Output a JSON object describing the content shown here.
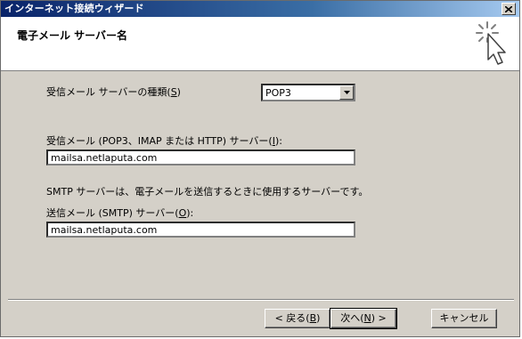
{
  "window": {
    "title": "インターネット接続ウィザード"
  },
  "header": {
    "title": "電子メール サーバー名"
  },
  "form": {
    "incoming_type_label_pre": "受信メール サーバーの種類(",
    "incoming_type_label_key": "S",
    "incoming_type_label_post": ")",
    "incoming_type_value": "POP3",
    "incoming_server_label_pre": "受信メール (POP3、IMAP または HTTP) サーバー(",
    "incoming_server_label_key": "I",
    "incoming_server_label_post": "):",
    "incoming_server_value": "mailsa.netlaputa.com",
    "smtp_note": "SMTP サーバーは、電子メールを送信するときに使用するサーバーです。",
    "outgoing_server_label_pre": "送信メール (SMTP) サーバー(",
    "outgoing_server_label_key": "O",
    "outgoing_server_label_post": "):",
    "outgoing_server_value": "mailsa.netlaputa.com"
  },
  "footer": {
    "back_pre": "< 戻る(",
    "back_key": "B",
    "back_post": ")",
    "next_pre": "次へ(",
    "next_key": "N",
    "next_post": ") >",
    "cancel": "キャンセル"
  },
  "icons": {
    "close": "close-icon",
    "dropdown": "chevron-down-icon",
    "wizard": "wizard-sparkle-cursor-icon"
  },
  "colors": {
    "titlebar_start": "#0a246a",
    "titlebar_end": "#a6caf0",
    "dialog_face": "#d4d0c8",
    "header_bg": "#ffffff"
  }
}
